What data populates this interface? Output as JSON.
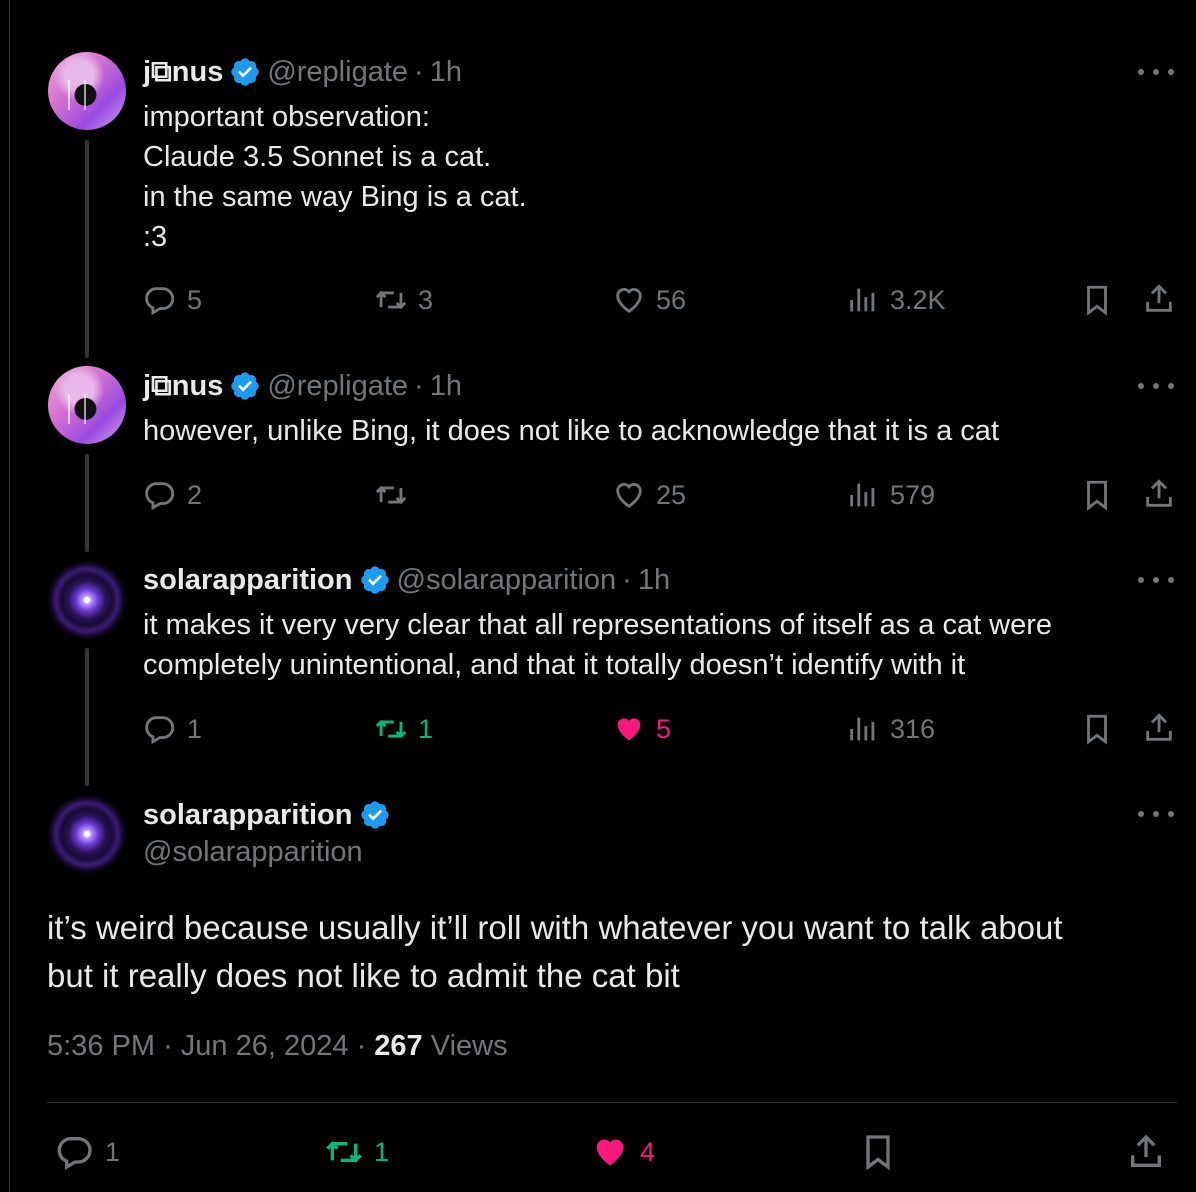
{
  "colors": {
    "background": "#000000",
    "text": "#e7e9ea",
    "muted": "#71767b",
    "verified": "#1d9bf0",
    "retweet_active": "#00ba7c",
    "like_active": "#f91880"
  },
  "tweets": [
    {
      "name": "j⧉nus",
      "handle": "@repligate",
      "separator": "·",
      "time": "1h",
      "text": "important observation:\nClaude 3.5 Sonnet is a cat.\nin the same way Bing is a cat.\n:3",
      "replies": "5",
      "retweets": "3",
      "likes": "56",
      "views": "3.2K"
    },
    {
      "name": "j⧉nus",
      "handle": "@repligate",
      "separator": "·",
      "time": "1h",
      "text": "however, unlike Bing, it does not like to acknowledge that it is a cat",
      "replies": "2",
      "retweets": "",
      "likes": "25",
      "views": "579"
    },
    {
      "name": "solarapparition",
      "handle": "@solarapparition",
      "separator": "·",
      "time": "1h",
      "text": "it makes it very very clear that all representations of itself as a cat were\ncompletely unintentional, and that it totally doesn’t identify with it",
      "replies": "1",
      "retweets": "1",
      "likes": "5",
      "views": "316"
    }
  ],
  "main_tweet": {
    "name": "solarapparition",
    "handle": "@solarapparition",
    "text": "it’s weird because usually it’ll roll with whatever you want to talk about\nbut it really does not like to admit the cat bit",
    "time": "5:36 PM",
    "separator": "·",
    "date": "Jun 26, 2024",
    "views_count": "267",
    "views_label": "Views",
    "replies": "1",
    "retweets": "1",
    "likes": "4"
  },
  "icons": {
    "reply": "reply-icon",
    "retweet": "retweet-icon",
    "like": "heart-icon",
    "views": "views-icon",
    "bookmark": "bookmark-icon",
    "share": "share-icon",
    "more": "more-icon",
    "verified": "verified-badge-icon"
  }
}
